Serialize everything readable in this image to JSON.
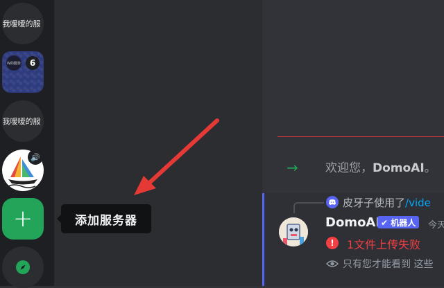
{
  "servers": {
    "server1_name": "我嗳嗳的服",
    "folder_mini_label": "W的服务",
    "folder_badge": "6",
    "server3_name": "我嗳嗳的服"
  },
  "tooltip": {
    "text": "添加服务器"
  },
  "welcome": {
    "prefix": "欢迎您，",
    "name": "DomoAI",
    "suffix": "。"
  },
  "message": {
    "reply_user": "皮牙子使用了",
    "reply_command": "/vide",
    "author": "DomoAI",
    "bot_tag": "✔ 机器人",
    "timestamp": "今天",
    "error": "1文件上传失败",
    "ephemeral": "只有您才能看到 这些"
  },
  "colors": {
    "accent": "#5865f2",
    "green": "#23a559",
    "error": "#f23f43",
    "new_divider": "#d83c3e"
  }
}
